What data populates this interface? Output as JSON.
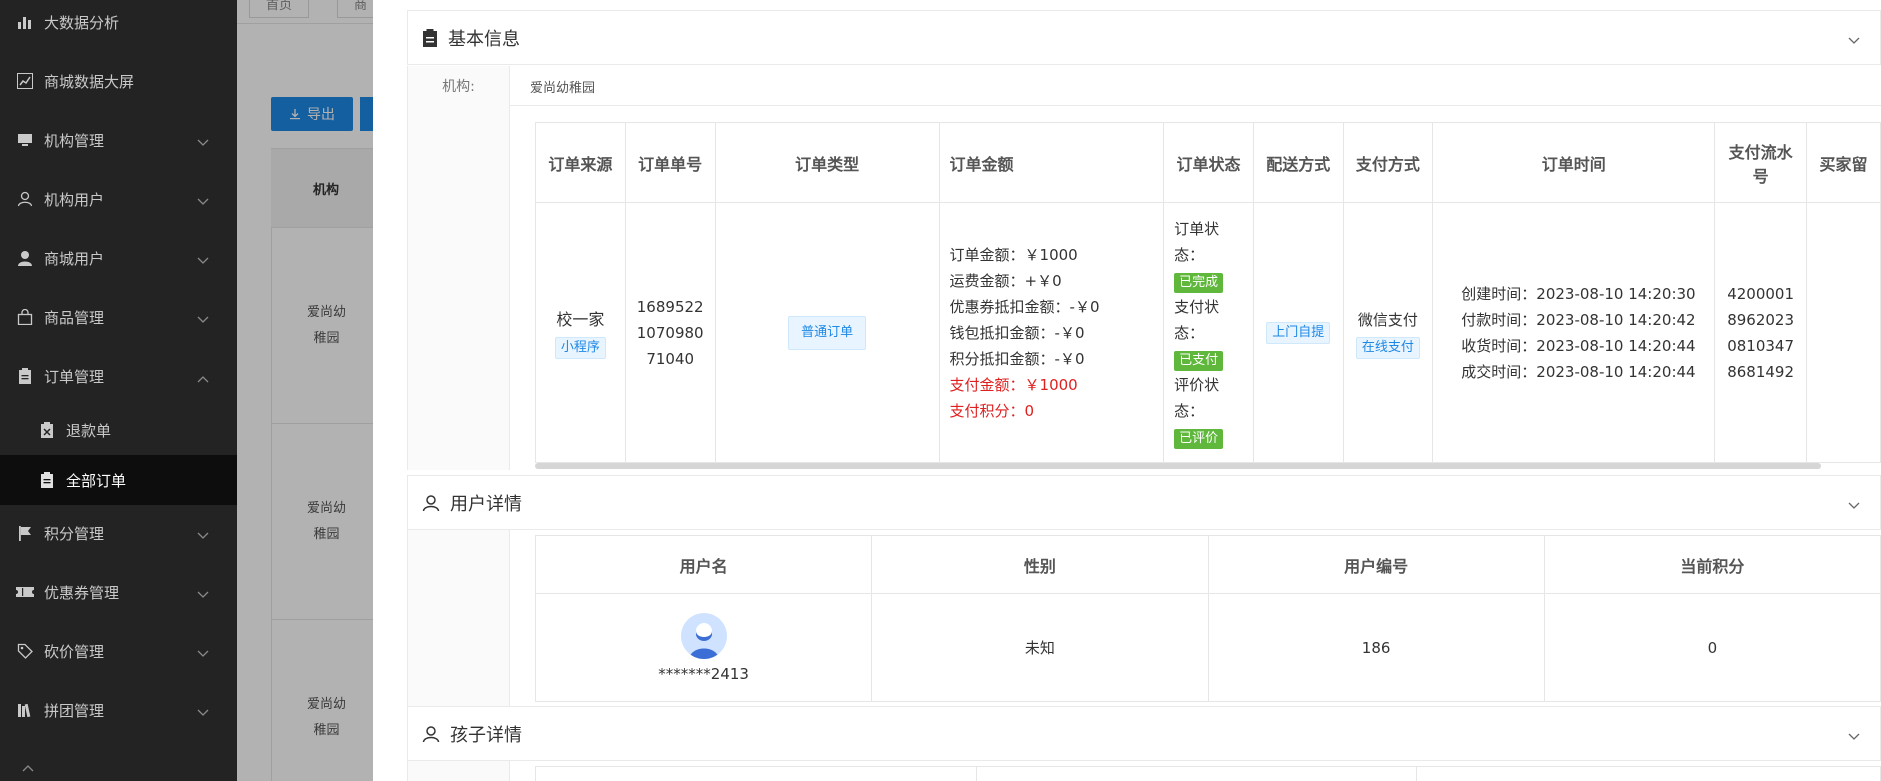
{
  "sidebar": {
    "items": [
      {
        "label": "大数据分析",
        "icon": "bar-chart-icon"
      },
      {
        "label": "商城数据大屏",
        "icon": "line-chart-icon"
      },
      {
        "label": "机构管理",
        "icon": "monitor-icon"
      },
      {
        "label": "机构用户",
        "icon": "user-outline-icon"
      },
      {
        "label": "商城用户",
        "icon": "user-solid-icon"
      },
      {
        "label": "商品管理",
        "icon": "bag-icon"
      },
      {
        "label": "订单管理",
        "icon": "clipboard-icon"
      },
      {
        "label": "退款单",
        "icon": "refund-doc-icon"
      },
      {
        "label": "全部订单",
        "icon": "clipboard-icon"
      },
      {
        "label": "积分管理",
        "icon": "flag-icon"
      },
      {
        "label": "优惠券管理",
        "icon": "ticket-icon"
      },
      {
        "label": "砍价管理",
        "icon": "discount-tag-icon"
      },
      {
        "label": "拼团管理",
        "icon": "books-icon"
      }
    ]
  },
  "background": {
    "tabs": [
      "首页",
      "商"
    ],
    "export_label": "导出",
    "column_header": "机构",
    "rows": [
      "爱尚幼稚园",
      "爱尚幼稚园",
      "爱尚幼稚园"
    ]
  },
  "basic_info": {
    "title": "基本信息",
    "org_label": "机构:",
    "org_value": "爱尚幼稚园",
    "headers": [
      "订单来源",
      "订单单号",
      "订单类型",
      "订单金额",
      "订单状态",
      "配送方式",
      "支付方式",
      "订单时间",
      "支付流水号",
      "买家留"
    ],
    "row": {
      "source": "校一家",
      "source_tag": "小程序",
      "order_no_lines": [
        "1689522",
        "1070980",
        "71040"
      ],
      "type_tag": "普通订单",
      "amount_lines": [
        "订单金额：￥1000",
        "运费金额：+￥0",
        "优惠券抵扣金额：-￥0",
        "钱包抵扣金额：-￥0",
        "积分抵扣金额：-￥0"
      ],
      "amount_red_lines": [
        "支付金额：￥1000",
        "支付积分：0"
      ],
      "status_groups": [
        {
          "label_1": "订单状",
          "label_2": "态：",
          "tag": "已完成"
        },
        {
          "label_1": "支付状",
          "label_2": "态：",
          "tag": "已支付"
        },
        {
          "label_1": "评价状",
          "label_2": "态：",
          "tag": "已评价"
        }
      ],
      "delivery_tag": "上门自提",
      "pay_method": "微信支付",
      "pay_tag": "在线支付",
      "times": [
        "创建时间：2023-08-10 14:20:30",
        "付款时间：2023-08-10 14:20:42",
        "收货时间：2023-08-10 14:20:44",
        "成交时间：2023-08-10 14:20:44"
      ],
      "flow_no_lines": [
        "4200001",
        "8962023",
        "0810347",
        "8681492"
      ]
    }
  },
  "user_detail": {
    "title": "用户详情",
    "headers": [
      "用户名",
      "性别",
      "用户编号",
      "当前积分"
    ],
    "username": "*******2413",
    "gender": "未知",
    "user_no": "186",
    "points": "0"
  },
  "child_detail": {
    "title": "孩子详情"
  },
  "colors": {
    "sidebar_bg": "#232323",
    "primary": "#1e88e5",
    "success": "#5fb83b",
    "danger": "#e02020"
  }
}
